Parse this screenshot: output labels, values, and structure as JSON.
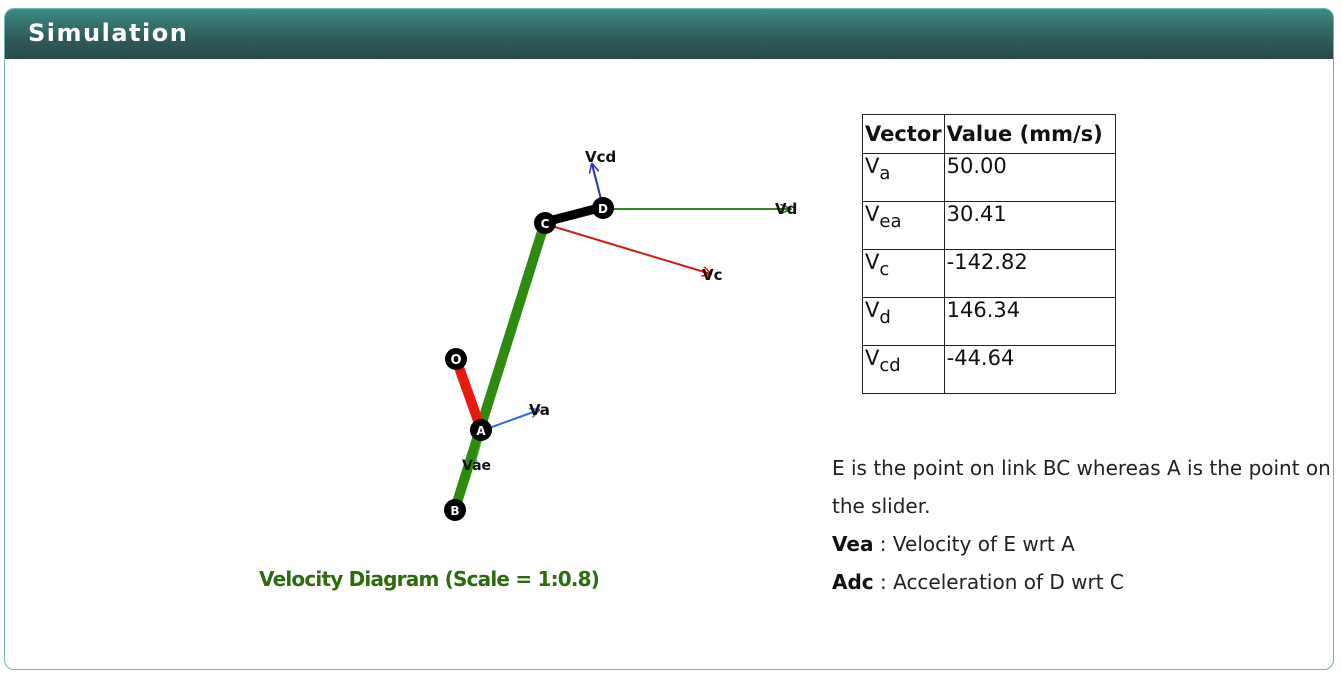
{
  "header": {
    "title": "Simulation"
  },
  "diagram": {
    "caption": "Velocity Diagram (Scale = 1:0.8)",
    "points": {
      "o": "O",
      "a": "A",
      "b": "B",
      "c": "C",
      "d": "D"
    },
    "vector_labels": {
      "vcd": "Vcd",
      "vd": "Vd",
      "vc": "Vc",
      "va": "Va",
      "vae": "Vae"
    },
    "colors": {
      "link_bc": "#2e8b10",
      "link_oa": "#e81a0c",
      "link_cd": "#000000",
      "vc": "#d11a1a",
      "vd": "#1f6b10",
      "va": "#3366ee",
      "vcd": "#2233bb",
      "vae": "#2e8b10",
      "caption": "#2e6b10"
    }
  },
  "table": {
    "headers": [
      "Vector",
      "Value (mm/s)"
    ],
    "rows": [
      {
        "base": "V",
        "sub": "a",
        "value": "50.00"
      },
      {
        "base": "V",
        "sub": "ea",
        "value": "30.41"
      },
      {
        "base": "V",
        "sub": "c",
        "value": "-142.82"
      },
      {
        "base": "V",
        "sub": "d",
        "value": "146.34"
      },
      {
        "base": "V",
        "sub": "cd",
        "value": "-44.64"
      }
    ]
  },
  "notes": {
    "line1": "E is the point on link BC whereas A is the point on the slider.",
    "vea_term": "Vea",
    "vea_desc": " : Velocity of E wrt A",
    "adc_term": "Adc",
    "adc_desc": " : Acceleration of D wrt C"
  }
}
